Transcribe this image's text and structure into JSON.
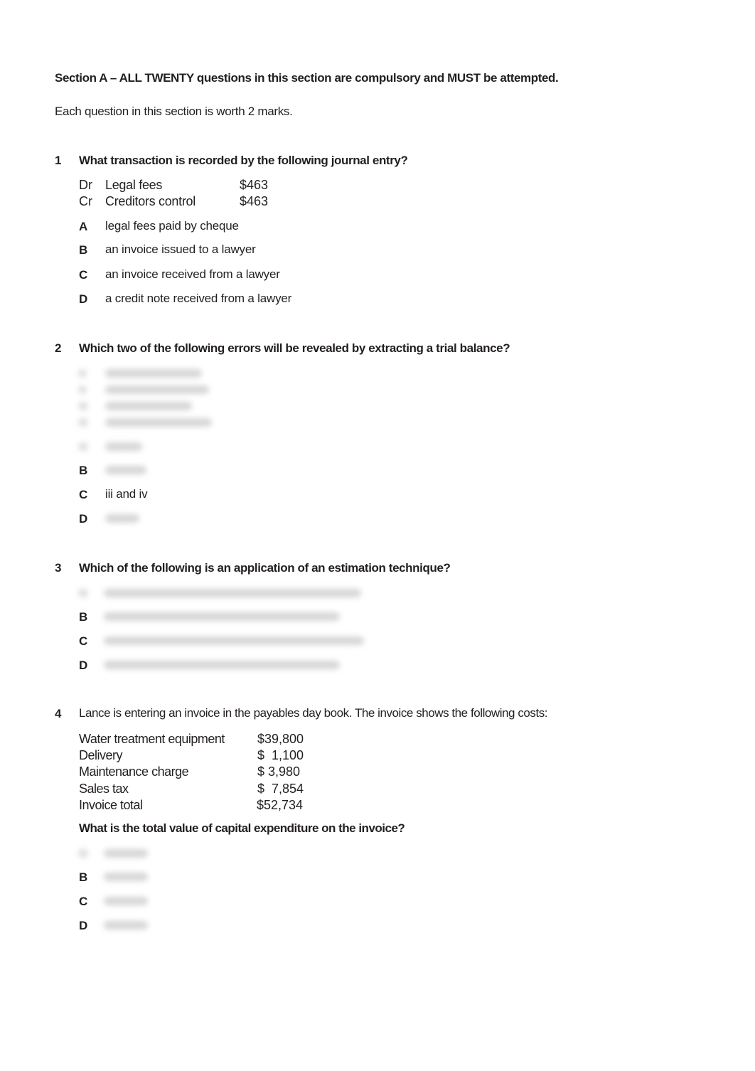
{
  "header": {
    "instructions": "Section A – ALL TWENTY questions in this section are compulsory and MUST be attempted.",
    "marks_note": "Each question in this section is worth 2 marks."
  },
  "questions": [
    {
      "number": "1",
      "text": "What transaction is recorded by the following journal entry?",
      "journal": [
        {
          "side": "Dr",
          "account": "Legal fees",
          "amount": "$463"
        },
        {
          "side": "Cr",
          "account": "Creditors control",
          "amount": "$463"
        }
      ],
      "options": [
        {
          "letter": "A",
          "text": "legal fees paid by cheque"
        },
        {
          "letter": "B",
          "text": "an invoice issued to a lawyer"
        },
        {
          "letter": "C",
          "text": "an invoice received from a lawyer"
        },
        {
          "letter": "D",
          "text": "a credit note received from a lawyer"
        }
      ]
    },
    {
      "number": "2",
      "text": "Which two of the following errors will be revealed by extracting a trial balance?",
      "options": [
        {
          "letter": "B",
          "text": ""
        },
        {
          "letter": "C",
          "text": "iii and iv"
        },
        {
          "letter": "D",
          "text": ""
        }
      ]
    },
    {
      "number": "3",
      "text": "Which of the following is an application of an estimation technique?",
      "options": [
        {
          "letter": "B",
          "text": ""
        },
        {
          "letter": "C",
          "text": ""
        },
        {
          "letter": "D",
          "text": ""
        }
      ]
    },
    {
      "number": "4",
      "text": "Lance is entering an invoice in the payables day book. The invoice shows the following costs:",
      "invoice": [
        {
          "item": "Water treatment equipment",
          "amount": "$39,800"
        },
        {
          "item": "Delivery",
          "amount": "$  1,100"
        },
        {
          "item": "Maintenance charge",
          "amount": "$ 3,980"
        },
        {
          "item": "Sales tax",
          "amount": "$  7,854"
        },
        {
          "item": "Invoice total",
          "amount": "$52,734"
        }
      ],
      "sub_question": "What is the total value of capital expenditure on the invoice?",
      "options": [
        {
          "letter": "B",
          "text": ""
        },
        {
          "letter": "C",
          "text": ""
        },
        {
          "letter": "D",
          "text": ""
        }
      ]
    }
  ]
}
